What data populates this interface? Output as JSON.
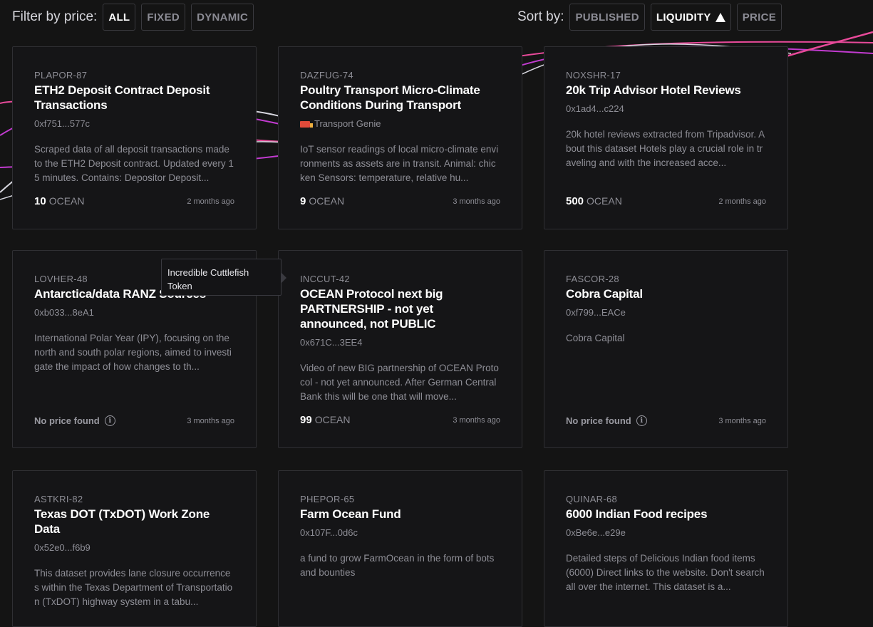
{
  "filter": {
    "label": "Filter by price:",
    "options": [
      "ALL",
      "FIXED",
      "DYNAMIC"
    ]
  },
  "sort": {
    "label": "Sort by:",
    "options": [
      "PUBLISHED",
      "LIQUIDITY",
      "PRICE"
    ]
  },
  "tooltip": {
    "text": "Incredible Cuttlefish Token"
  },
  "cards": [
    {
      "symbol": "PLAPOR-87",
      "title": "ETH2 Deposit Contract Deposit Transactions",
      "address": "0xf751...577c",
      "description": "Scraped data of all deposit transactions made to the ETH2 Deposit contract. Updated every 15 minutes. Contains: Depositor Deposit...",
      "price": "10",
      "currency": "OCEAN",
      "time": "2 months ago"
    },
    {
      "symbol": "DAZFUG-74",
      "title": "Poultry Transport Micro-Climate Conditions During Transport",
      "address": "Transport Genie",
      "description": "IoT sensor readings of local micro-climate environments as assets are in transit. Animal: chicken Sensors: temperature, relative hu...",
      "price": "9",
      "currency": "OCEAN",
      "time": "3 months ago"
    },
    {
      "symbol": "NOXSHR-17",
      "title": "20k Trip Advisor Hotel Reviews",
      "address": "0x1ad4...c224",
      "description": "20k hotel reviews extracted from Tripadvisor. About this dataset Hotels play a crucial role in traveling and with the increased acce...",
      "price": "500",
      "currency": "OCEAN",
      "time": "2 months ago"
    },
    {
      "symbol": "LOVHER-48",
      "title": "Antarctica/data RANZ Sources",
      "address": "0xb033...8eA1",
      "description": "International Polar Year (IPY), focusing on the north and south polar regions, aimed to investigate the impact of how changes to th...",
      "noprice": "No price found",
      "time": "3 months ago"
    },
    {
      "symbol": "INCCUT-42",
      "title": "OCEAN Protocol next big PARTNERSHIP - not yet announced, not PUBLIC",
      "address": "0x671C...3EE4",
      "description": "Video of new BIG partnership of OCEAN Protocol - not yet announced. After German Central Bank this will be one that will move...",
      "price": "99",
      "currency": "OCEAN",
      "time": "3 months ago"
    },
    {
      "symbol": "FASCOR-28",
      "title": "Cobra Capital",
      "address": "0xf799...EACe",
      "description": "Cobra Capital",
      "noprice": "No price found",
      "time": "3 months ago"
    },
    {
      "symbol": "ASTKRI-82",
      "title": "Texas DOT (TxDOT) Work Zone Data",
      "address": "0x52e0...f6b9",
      "description": "This dataset provides lane closure occurrences within the Texas Department of Transportation (TxDOT) highway system in a tabu...",
      "time": ""
    },
    {
      "symbol": "PHEPOR-65",
      "title": "Farm Ocean Fund",
      "address": "0x107F...0d6c",
      "description": "a fund to grow FarmOcean in the form of bots and bounties",
      "time": ""
    },
    {
      "symbol": "QUINAR-68",
      "title": "6000 Indian Food recipes",
      "address": "0xBe6e...e29e",
      "description": "Detailed steps of Delicious Indian food items (6000) Direct links to the website. Don't search all over the internet. This dataset is a...",
      "time": ""
    }
  ]
}
